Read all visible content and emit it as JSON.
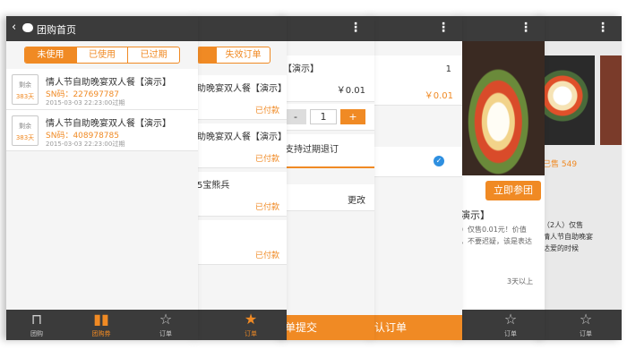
{
  "colors": {
    "accent": "#f08a24",
    "bar": "#3b3b3b"
  },
  "s1": {
    "title": "团购首页",
    "tabs": [
      "未使用",
      "已使用",
      "已过期"
    ],
    "items": [
      {
        "title": "情人节自助晚宴双人餐【演示】",
        "sn": "SN码：227697787",
        "date": "2015-03-03 22:23:00过期",
        "cal_top": "剩余",
        "cal_bot": "383天"
      },
      {
        "title": "情人节自助晚宴双人餐【演示】",
        "sn": "SN码：408978785",
        "date": "2015-03-03 22:23:00过期",
        "cal_top": "剩余",
        "cal_bot": "383天"
      }
    ],
    "nav": [
      "团购",
      "团购券",
      "订单"
    ]
  },
  "s2": {
    "tab_left": "…",
    "tab_right": "失效订单",
    "rows": [
      "助晚宴双人餐【演示】",
      "助晚宴双人餐【演示】",
      "5宝熊兵",
      ""
    ],
    "paid": "已付款",
    "nav": "订单"
  },
  "s3": {
    "title": "【演示】",
    "price": "￥0.01",
    "minus": "-",
    "qty": "1",
    "plus": "+",
    "refund": "支持过期退订",
    "change": "更改",
    "submit": "单提交"
  },
  "s4": {
    "qty": "1",
    "price": "￥0.01",
    "confirm": "认订单"
  },
  "s5": {
    "sold_label": "已售",
    "sold": "549",
    "join": "立即参团",
    "t1": "餐【...",
    "t2": "演示】",
    "d1": "）仅售0.01元！价值",
    "d2": "，不要迟疑，该是表达",
    "days": "3天以上",
    "nav": "订单"
  },
  "s6": {
    "desc1": "（2人）仅售",
    "desc2": "情人节自助晚宴",
    "desc3": "达爱的时候",
    "nav": "订单"
  }
}
